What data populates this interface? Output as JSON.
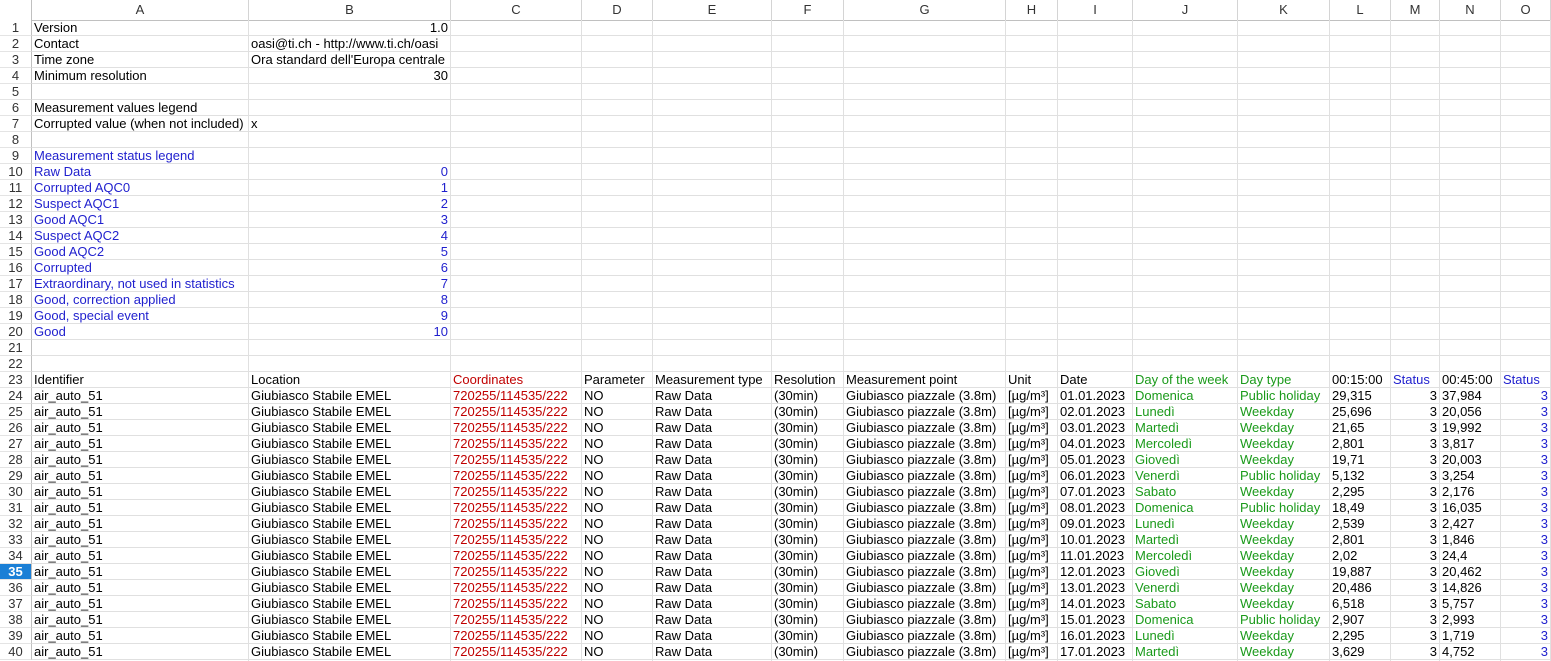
{
  "columns": [
    "A",
    "B",
    "C",
    "D",
    "E",
    "F",
    "G",
    "H",
    "I",
    "J",
    "K",
    "L",
    "M",
    "N",
    "O"
  ],
  "active_row": "35",
  "colors": {
    "blue": "#1f1fce",
    "red": "#c00000",
    "green": "#1a9a1a",
    "active_row": "#1a7fd6"
  },
  "meta": {
    "version_label": "Version",
    "version_value": "1.0",
    "contact_label": "Contact",
    "contact_value": "oasi@ti.ch - http://www.ti.ch/oasi",
    "timezone_label": "Time zone",
    "timezone_value": "Ora standard dell'Europa centrale",
    "minres_label": "Minimum resolution",
    "minres_value": "30",
    "mv_legend_label": "Measurement values legend",
    "corrupted_label": "Corrupted value (when not included)",
    "corrupted_value": "x"
  },
  "status_legend": {
    "title": "Measurement status legend",
    "items": [
      {
        "label": "Raw Data",
        "code": "0"
      },
      {
        "label": "Corrupted AQC0",
        "code": "1"
      },
      {
        "label": "Suspect AQC1",
        "code": "2"
      },
      {
        "label": "Good AQC1",
        "code": "3"
      },
      {
        "label": "Suspect AQC2",
        "code": "4"
      },
      {
        "label": "Good AQC2",
        "code": "5"
      },
      {
        "label": "Corrupted",
        "code": "6"
      },
      {
        "label": "Extraordinary, not used in statistics",
        "code": "7"
      },
      {
        "label": "Good, correction applied",
        "code": "8"
      },
      {
        "label": "Good, special event",
        "code": "9"
      },
      {
        "label": "Good",
        "code": "10"
      }
    ]
  },
  "table": {
    "headers": [
      "Identifier",
      "Location",
      "Coordinates",
      "Parameter",
      "Measurement type",
      "Resolution",
      "Measurement point",
      "Unit",
      "Date",
      "Day of the week",
      "Day type",
      "00:15:00",
      "Status",
      "00:45:00",
      "Status"
    ],
    "rows": [
      [
        "air_auto_51",
        "Giubiasco Stabile EMEL",
        "720255/114535/222",
        "NO",
        "Raw Data",
        "(30min)",
        "Giubiasco piazzale (3.8m)",
        "[µg/m³]",
        "01.01.2023",
        "Domenica",
        "Public holiday",
        "29,315",
        "3",
        "37,984",
        "3"
      ],
      [
        "air_auto_51",
        "Giubiasco Stabile EMEL",
        "720255/114535/222",
        "NO",
        "Raw Data",
        "(30min)",
        "Giubiasco piazzale (3.8m)",
        "[µg/m³]",
        "02.01.2023",
        "Lunedì",
        "Weekday",
        "25,696",
        "3",
        "20,056",
        "3"
      ],
      [
        "air_auto_51",
        "Giubiasco Stabile EMEL",
        "720255/114535/222",
        "NO",
        "Raw Data",
        "(30min)",
        "Giubiasco piazzale (3.8m)",
        "[µg/m³]",
        "03.01.2023",
        "Martedì",
        "Weekday",
        "21,65",
        "3",
        "19,992",
        "3"
      ],
      [
        "air_auto_51",
        "Giubiasco Stabile EMEL",
        "720255/114535/222",
        "NO",
        "Raw Data",
        "(30min)",
        "Giubiasco piazzale (3.8m)",
        "[µg/m³]",
        "04.01.2023",
        "Mercoledì",
        "Weekday",
        "2,801",
        "3",
        "3,817",
        "3"
      ],
      [
        "air_auto_51",
        "Giubiasco Stabile EMEL",
        "720255/114535/222",
        "NO",
        "Raw Data",
        "(30min)",
        "Giubiasco piazzale (3.8m)",
        "[µg/m³]",
        "05.01.2023",
        "Giovedì",
        "Weekday",
        "19,71",
        "3",
        "20,003",
        "3"
      ],
      [
        "air_auto_51",
        "Giubiasco Stabile EMEL",
        "720255/114535/222",
        "NO",
        "Raw Data",
        "(30min)",
        "Giubiasco piazzale (3.8m)",
        "[µg/m³]",
        "06.01.2023",
        "Venerdì",
        "Public holiday",
        "5,132",
        "3",
        "3,254",
        "3"
      ],
      [
        "air_auto_51",
        "Giubiasco Stabile EMEL",
        "720255/114535/222",
        "NO",
        "Raw Data",
        "(30min)",
        "Giubiasco piazzale (3.8m)",
        "[µg/m³]",
        "07.01.2023",
        "Sabato",
        "Weekday",
        "2,295",
        "3",
        "2,176",
        "3"
      ],
      [
        "air_auto_51",
        "Giubiasco Stabile EMEL",
        "720255/114535/222",
        "NO",
        "Raw Data",
        "(30min)",
        "Giubiasco piazzale (3.8m)",
        "[µg/m³]",
        "08.01.2023",
        "Domenica",
        "Public holiday",
        "18,49",
        "3",
        "16,035",
        "3"
      ],
      [
        "air_auto_51",
        "Giubiasco Stabile EMEL",
        "720255/114535/222",
        "NO",
        "Raw Data",
        "(30min)",
        "Giubiasco piazzale (3.8m)",
        "[µg/m³]",
        "09.01.2023",
        "Lunedì",
        "Weekday",
        "2,539",
        "3",
        "2,427",
        "3"
      ],
      [
        "air_auto_51",
        "Giubiasco Stabile EMEL",
        "720255/114535/222",
        "NO",
        "Raw Data",
        "(30min)",
        "Giubiasco piazzale (3.8m)",
        "[µg/m³]",
        "10.01.2023",
        "Martedì",
        "Weekday",
        "2,801",
        "3",
        "1,846",
        "3"
      ],
      [
        "air_auto_51",
        "Giubiasco Stabile EMEL",
        "720255/114535/222",
        "NO",
        "Raw Data",
        "(30min)",
        "Giubiasco piazzale (3.8m)",
        "[µg/m³]",
        "11.01.2023",
        "Mercoledì",
        "Weekday",
        "2,02",
        "3",
        "24,4",
        "3"
      ],
      [
        "air_auto_51",
        "Giubiasco Stabile EMEL",
        "720255/114535/222",
        "NO",
        "Raw Data",
        "(30min)",
        "Giubiasco piazzale (3.8m)",
        "[µg/m³]",
        "12.01.2023",
        "Giovedì",
        "Weekday",
        "19,887",
        "3",
        "20,462",
        "3"
      ],
      [
        "air_auto_51",
        "Giubiasco Stabile EMEL",
        "720255/114535/222",
        "NO",
        "Raw Data",
        "(30min)",
        "Giubiasco piazzale (3.8m)",
        "[µg/m³]",
        "13.01.2023",
        "Venerdì",
        "Weekday",
        "20,486",
        "3",
        "14,826",
        "3"
      ],
      [
        "air_auto_51",
        "Giubiasco Stabile EMEL",
        "720255/114535/222",
        "NO",
        "Raw Data",
        "(30min)",
        "Giubiasco piazzale (3.8m)",
        "[µg/m³]",
        "14.01.2023",
        "Sabato",
        "Weekday",
        "6,518",
        "3",
        "5,757",
        "3"
      ],
      [
        "air_auto_51",
        "Giubiasco Stabile EMEL",
        "720255/114535/222",
        "NO",
        "Raw Data",
        "(30min)",
        "Giubiasco piazzale (3.8m)",
        "[µg/m³]",
        "15.01.2023",
        "Domenica",
        "Public holiday",
        "2,907",
        "3",
        "2,993",
        "3"
      ],
      [
        "air_auto_51",
        "Giubiasco Stabile EMEL",
        "720255/114535/222",
        "NO",
        "Raw Data",
        "(30min)",
        "Giubiasco piazzale (3.8m)",
        "[µg/m³]",
        "16.01.2023",
        "Lunedì",
        "Weekday",
        "2,295",
        "3",
        "1,719",
        "3"
      ],
      [
        "air_auto_51",
        "Giubiasco Stabile EMEL",
        "720255/114535/222",
        "NO",
        "Raw Data",
        "(30min)",
        "Giubiasco piazzale (3.8m)",
        "[µg/m³]",
        "17.01.2023",
        "Martedì",
        "Weekday",
        "3,629",
        "3",
        "4,752",
        "3"
      ]
    ]
  }
}
